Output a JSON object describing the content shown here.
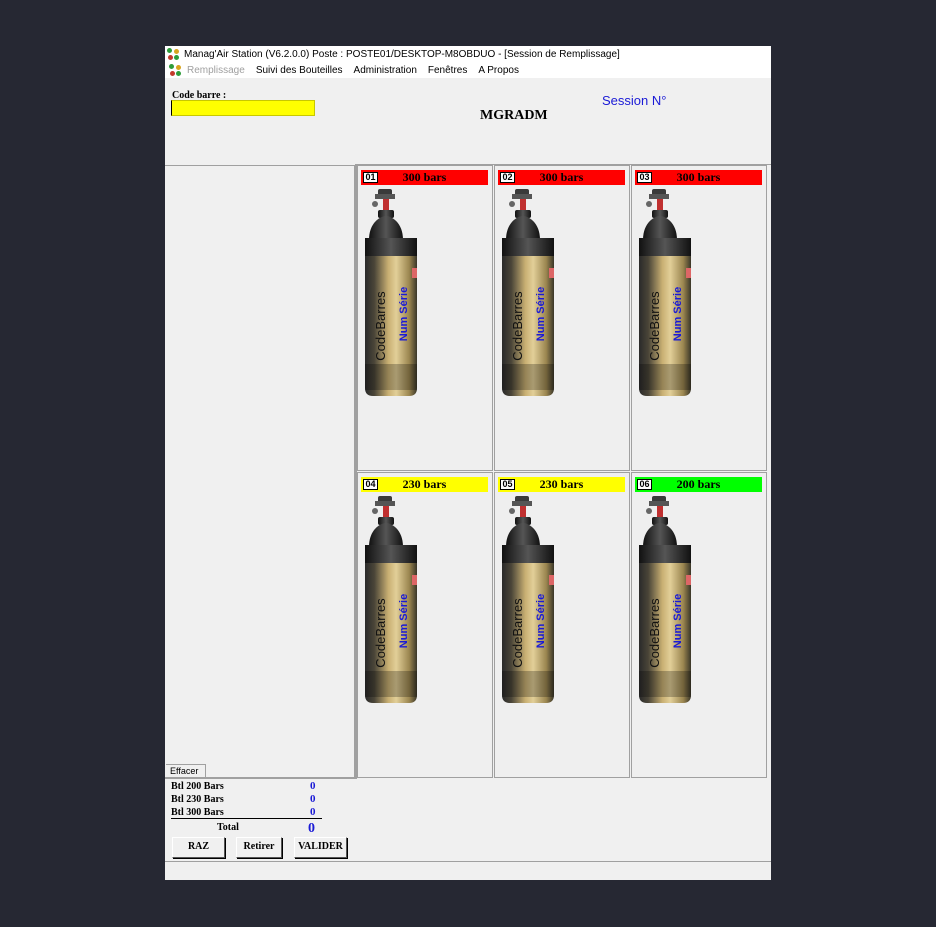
{
  "window": {
    "title": "Manag'Air Station (V6.2.0.0)  Poste : POSTE01/DESKTOP-M8OBDUO - [Session de Remplissage]"
  },
  "menu": {
    "items": [
      "Remplissage",
      "Suivi des Bouteilles",
      "Administration",
      "Fenêtres",
      "A Propos"
    ]
  },
  "form": {
    "code_label": "Code barre :",
    "code_value": "",
    "username": "MGRADM",
    "session_label": "Session N°"
  },
  "slots": [
    {
      "num": "01",
      "pressure": "300 bars",
      "color": "#ff0000"
    },
    {
      "num": "02",
      "pressure": "300 bars",
      "color": "#ff0000"
    },
    {
      "num": "03",
      "pressure": "300 bars",
      "color": "#ff0000"
    },
    {
      "num": "04",
      "pressure": "230 bars",
      "color": "#ffff00"
    },
    {
      "num": "05",
      "pressure": "230 bars",
      "color": "#ffff00"
    },
    {
      "num": "06",
      "pressure": "200 bars",
      "color": "#00ff00"
    }
  ],
  "bottle": {
    "code_text": "CodeBarres",
    "serial_text": "Num Série"
  },
  "left_panel": {
    "effacer_label": "Effacer"
  },
  "stats": {
    "btl200_label": "Btl 200 Bars",
    "btl200_value": "0",
    "btl230_label": "Btl 230 Bars",
    "btl230_value": "0",
    "btl300_label": "Btl 300 Bars",
    "btl300_value": "0",
    "total_label": "Total",
    "total_value": "0"
  },
  "buttons": {
    "raz": "RAZ",
    "retirer": "Retirer",
    "valider": "VALIDER"
  },
  "colors": {
    "accent_blue": "#1a1ad6",
    "input_yellow": "#ffff00"
  }
}
